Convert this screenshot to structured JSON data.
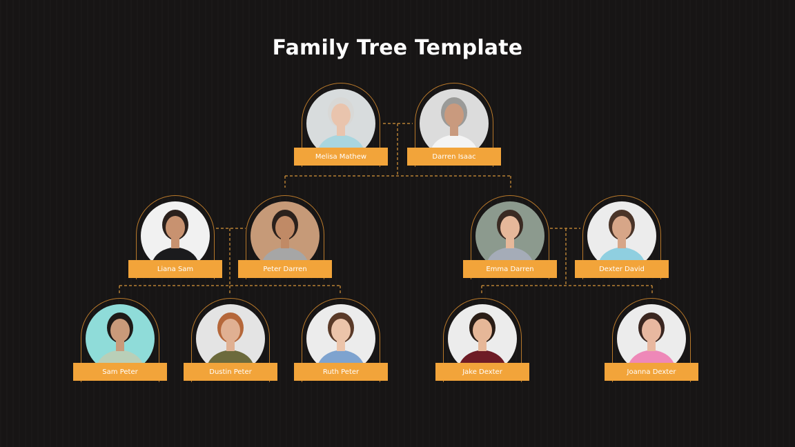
{
  "title": "Family Tree Template",
  "colors": {
    "background": "#171515",
    "accent": "#f2a43a",
    "arch_outline": "#b9792a",
    "connector": "#d9963a",
    "title_text": "#ffffff",
    "name_text": "#ffffff"
  },
  "generations": [
    {
      "level": 1,
      "members": [
        {
          "id": "melisa",
          "name": "Melisa Mathew",
          "photo": {
            "bg": "#d8dcdd",
            "skin": "#e9c4ad",
            "hair": "#d8d8d6",
            "shirt": "#a9d6df"
          }
        },
        {
          "id": "darren",
          "name": "Darren  Isaac",
          "photo": {
            "bg": "#dcdcdc",
            "skin": "#c99a7e",
            "hair": "#9a9a98",
            "shirt": "#f4f4f4"
          }
        }
      ]
    },
    {
      "level": 2,
      "members": [
        {
          "id": "liana",
          "name": "Liana Sam",
          "photo": {
            "bg": "#f1f1f1",
            "skin": "#c89270",
            "hair": "#2a201c",
            "shirt": "#1b1b1d"
          }
        },
        {
          "id": "peter",
          "name": "Peter  Darren",
          "photo": {
            "bg": "#c69a78",
            "skin": "#c08a66",
            "hair": "#2b211c",
            "shirt": "#a6a6a6"
          }
        },
        {
          "id": "emma",
          "name": "Emma Darren",
          "photo": {
            "bg": "#8c9a8e",
            "skin": "#e6b89a",
            "hair": "#3a2a22",
            "shirt": "#a5acb8"
          }
        },
        {
          "id": "dexter",
          "name": "Dexter  David",
          "photo": {
            "bg": "#ececec",
            "skin": "#d7a688",
            "hair": "#4a3428",
            "shirt": "#8fcfe0"
          }
        }
      ]
    },
    {
      "level": 3,
      "members": [
        {
          "id": "sam",
          "name": "Sam Peter",
          "photo": {
            "bg": "#8fdcd9",
            "skin": "#c99a7a",
            "hair": "#1e1a18",
            "shirt": "#b9cfb8"
          }
        },
        {
          "id": "dustin",
          "name": "Dustin Peter",
          "photo": {
            "bg": "#e4e4e4",
            "skin": "#e0b092",
            "hair": "#b5673a",
            "shirt": "#6c6a3c"
          }
        },
        {
          "id": "ruth",
          "name": "Ruth Peter",
          "photo": {
            "bg": "#ececec",
            "skin": "#ecc4aa",
            "hair": "#5a3a28",
            "shirt": "#7ea3cf"
          }
        },
        {
          "id": "jake",
          "name": "Jake Dexter",
          "photo": {
            "bg": "#ececec",
            "skin": "#e6b798",
            "hair": "#2a1d16",
            "shirt": "#6e1c26"
          }
        },
        {
          "id": "joanna",
          "name": "Joanna Dexter",
          "photo": {
            "bg": "#ececec",
            "skin": "#e8b8a0",
            "hair": "#3a2620",
            "shirt": "#ee88b8"
          }
        }
      ]
    }
  ],
  "relationships": [
    {
      "type": "couple",
      "partners": [
        "melisa",
        "darren"
      ],
      "children": [
        "peter",
        "emma"
      ]
    },
    {
      "type": "couple",
      "partners": [
        "liana",
        "peter"
      ],
      "children": [
        "sam",
        "dustin",
        "ruth"
      ]
    },
    {
      "type": "couple",
      "partners": [
        "emma",
        "dexter"
      ],
      "children": [
        "jake",
        "joanna"
      ]
    }
  ]
}
